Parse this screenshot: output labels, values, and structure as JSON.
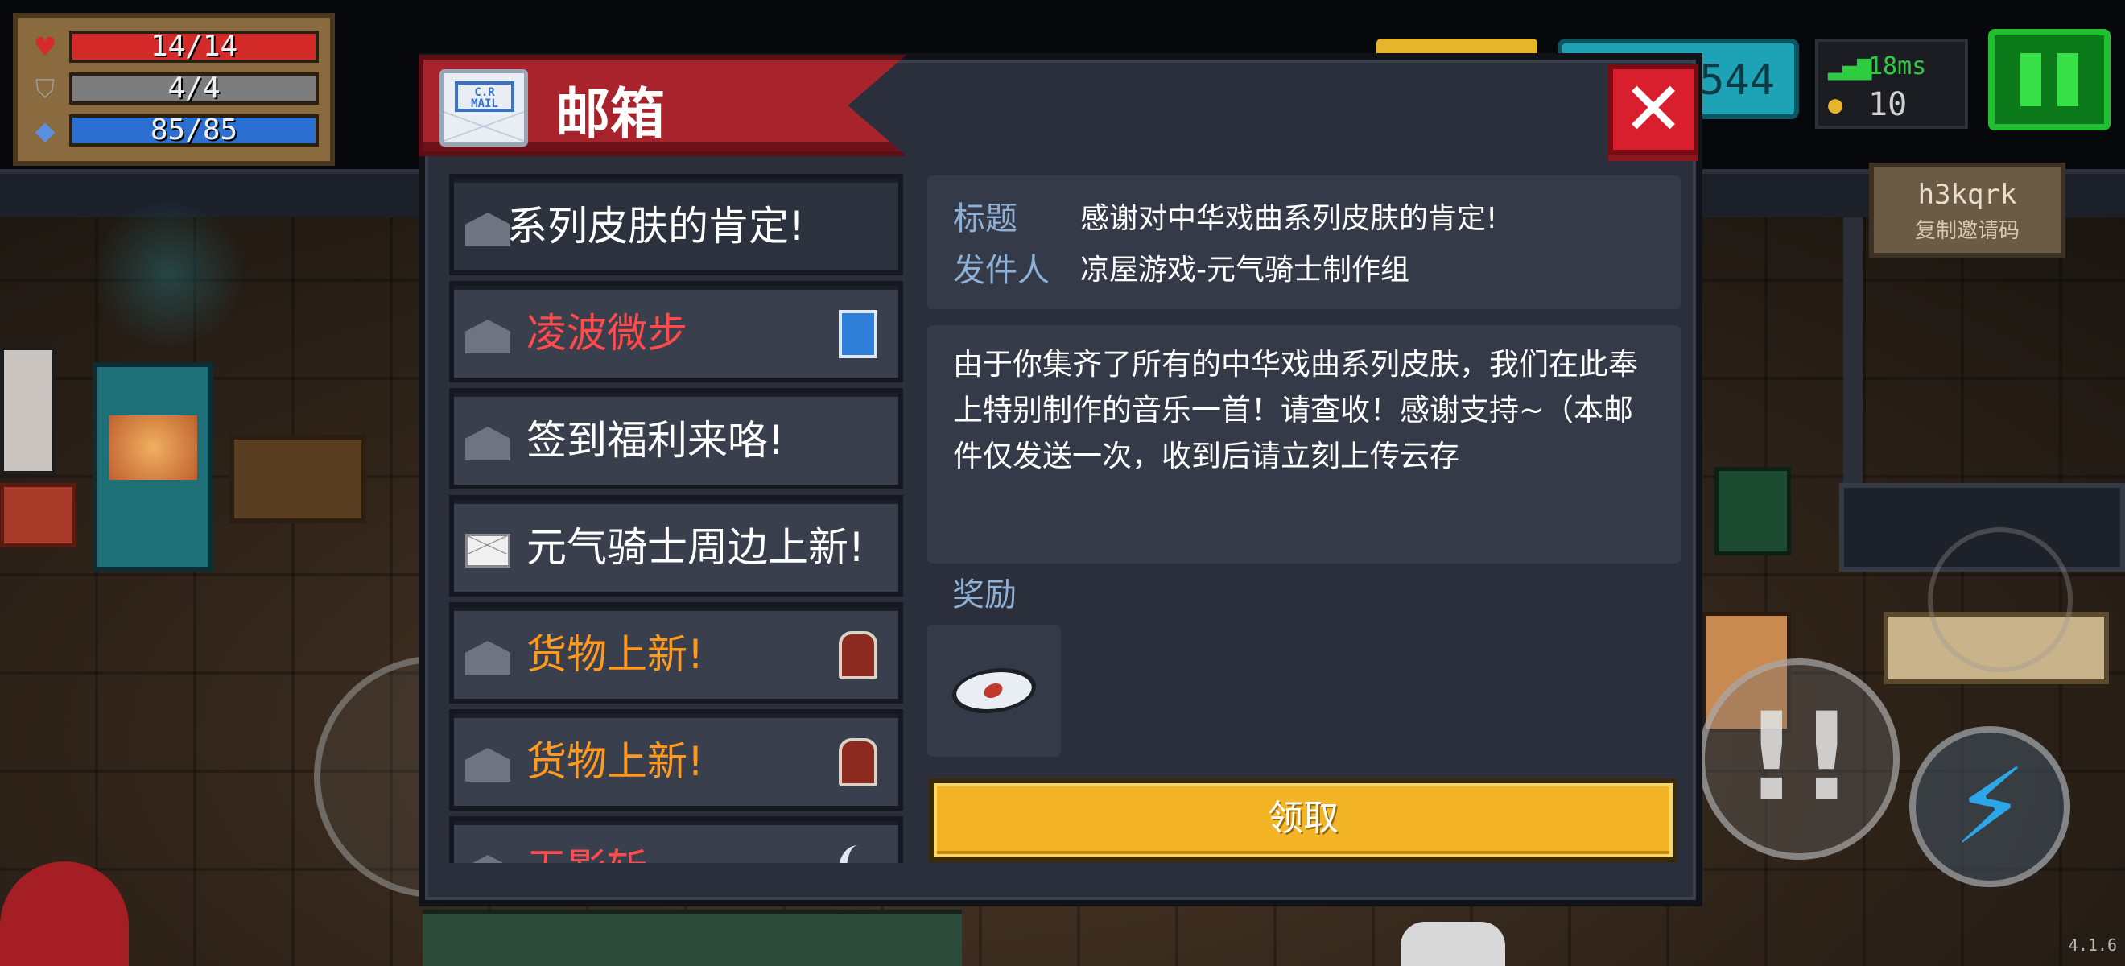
{
  "hud": {
    "hp": "14/14",
    "armor": "4/4",
    "energy": "85/85",
    "coins": "544",
    "ping": "18ms",
    "gems": "10",
    "invite_code": "h3kqrk",
    "invite_label": "复制邀请码",
    "version": "4.1.6",
    "colors": {
      "hp": "#d42a2a",
      "armor": "#7d7d7d",
      "energy": "#2b6fd0"
    }
  },
  "mail": {
    "title": "邮箱",
    "stamp_text": "C.R MAIL",
    "close_symbol": "✕",
    "items": [
      {
        "subject": "系列皮肤的肯定!",
        "color": "#ffffff",
        "envelope": "open",
        "thumb": ""
      },
      {
        "subject": "凌波微步",
        "color": "#ff4b4b",
        "envelope": "open",
        "thumb": "book"
      },
      {
        "subject": "签到福利来咯!",
        "color": "#ffffff",
        "envelope": "open",
        "thumb": ""
      },
      {
        "subject": "元气骑士周边上新!",
        "color": "#ffffff",
        "envelope": "closed",
        "thumb": ""
      },
      {
        "subject": "货物上新!",
        "color": "#ff9a1f",
        "envelope": "open",
        "thumb": "hero"
      },
      {
        "subject": "货物上新!",
        "color": "#ff9a1f",
        "envelope": "open",
        "thumb": "hero"
      },
      {
        "subject": "无影斩",
        "color": "#ff4b4b",
        "envelope": "open",
        "thumb": "moon"
      }
    ],
    "detail": {
      "subject_label": "标题",
      "subject": "感谢对中华戏曲系列皮肤的肯定!",
      "sender_label": "发件人",
      "sender": "凉屋游戏-元气骑士制作组",
      "body": "由于你集齐了所有的中华戏曲系列皮肤，我们在此奉上特别制作的音乐一首！请查收！感谢支持~（本邮件仅发送一次，收到后请立刻上传云存",
      "reward_label": "奖励",
      "reward_icon": "music-disc-icon",
      "claim_label": "领取"
    }
  }
}
